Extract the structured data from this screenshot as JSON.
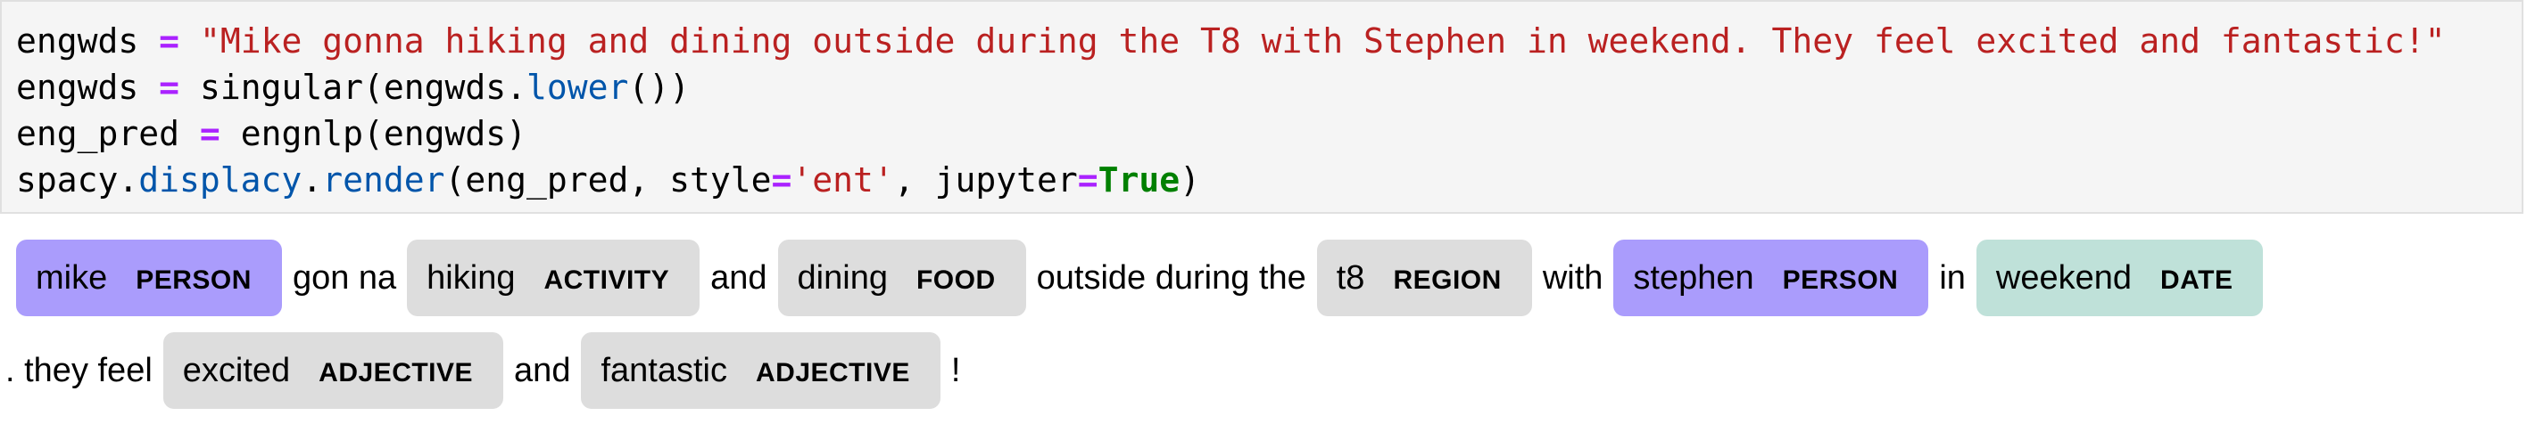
{
  "code": {
    "line1": {
      "var": "engwds",
      "op": "=",
      "str": "\"Mike gonna hiking and dining outside during the T8 with Stephen in weekend. They feel excited and fantastic!\""
    },
    "line2": {
      "var": "engwds",
      "op": "=",
      "func": "singular(engwds.",
      "method": "lower",
      "tail": "())"
    },
    "line3": {
      "var": "eng_pred",
      "op": "=",
      "call": "engnlp(engwds)"
    },
    "line4": {
      "obj": "spacy.",
      "mod": "displacy",
      "dot": ".",
      "method": "render",
      "args_a": "(eng_pred, style",
      "eq1": "=",
      "style_val": "'ent'",
      "args_b": ", jupyter",
      "eq2": "=",
      "kw": "True",
      "close": ")"
    }
  },
  "colors": {
    "person": "#aa9cfc",
    "other": "#dddddd",
    "date": "#bfe1d9"
  },
  "output": {
    "row1": [
      {
        "type": "ent",
        "text": "mike",
        "label": "PERSON",
        "color": "#aa9cfc"
      },
      {
        "type": "word",
        "text": "gon na"
      },
      {
        "type": "ent",
        "text": "hiking",
        "label": "ACTIVITY",
        "color": "#dddddd"
      },
      {
        "type": "word",
        "text": "and"
      },
      {
        "type": "ent",
        "text": "dining",
        "label": "FOOD",
        "color": "#dddddd"
      },
      {
        "type": "word",
        "text": "outside during the"
      },
      {
        "type": "ent",
        "text": "t8",
        "label": "REGION",
        "color": "#dddddd"
      },
      {
        "type": "word",
        "text": "with"
      },
      {
        "type": "ent",
        "text": "stephen",
        "label": "PERSON",
        "color": "#aa9cfc"
      },
      {
        "type": "word",
        "text": "in"
      },
      {
        "type": "ent",
        "text": "weekend",
        "label": "DATE",
        "color": "#bfe1d9"
      }
    ],
    "row2": [
      {
        "type": "word",
        "text": ". they feel"
      },
      {
        "type": "ent",
        "text": "excited",
        "label": "ADJECTIVE",
        "color": "#dddddd"
      },
      {
        "type": "word",
        "text": "and"
      },
      {
        "type": "ent",
        "text": "fantastic",
        "label": "ADJECTIVE",
        "color": "#dddddd"
      },
      {
        "type": "word",
        "text": "!"
      }
    ]
  }
}
